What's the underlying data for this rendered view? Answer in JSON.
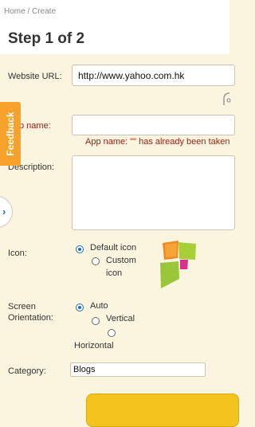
{
  "breadcrumb": "Home / Create",
  "page_title": "Step 1 of 2",
  "form": {
    "website_url_label": "Website URL:",
    "website_url_value": "http://www.yahoo.com.hk",
    "app_name_label": "p name:",
    "app_name_value": "",
    "app_name_error": "App name: \"\" has already been taken",
    "description_label": "Description:",
    "description_value": "",
    "icon_label": "Icon:",
    "icon_options": [
      "Default icon",
      "Custom",
      "icon"
    ],
    "orientation_label_1": "Screen",
    "orientation_label_2": "Orientation:",
    "orientation_options": [
      "Auto",
      "Vertical",
      "Horizontal"
    ],
    "category_label": "Category:",
    "category_value": "Blogs"
  },
  "feedback_tab": "Feedback",
  "side_tab_icon": "chevron-right-icon",
  "colors": {
    "background": "#fbf4de",
    "feedback": "#f7a22a",
    "error": "#a31d14",
    "accent": "#1a6fc0",
    "submit": "#f3c41d"
  }
}
